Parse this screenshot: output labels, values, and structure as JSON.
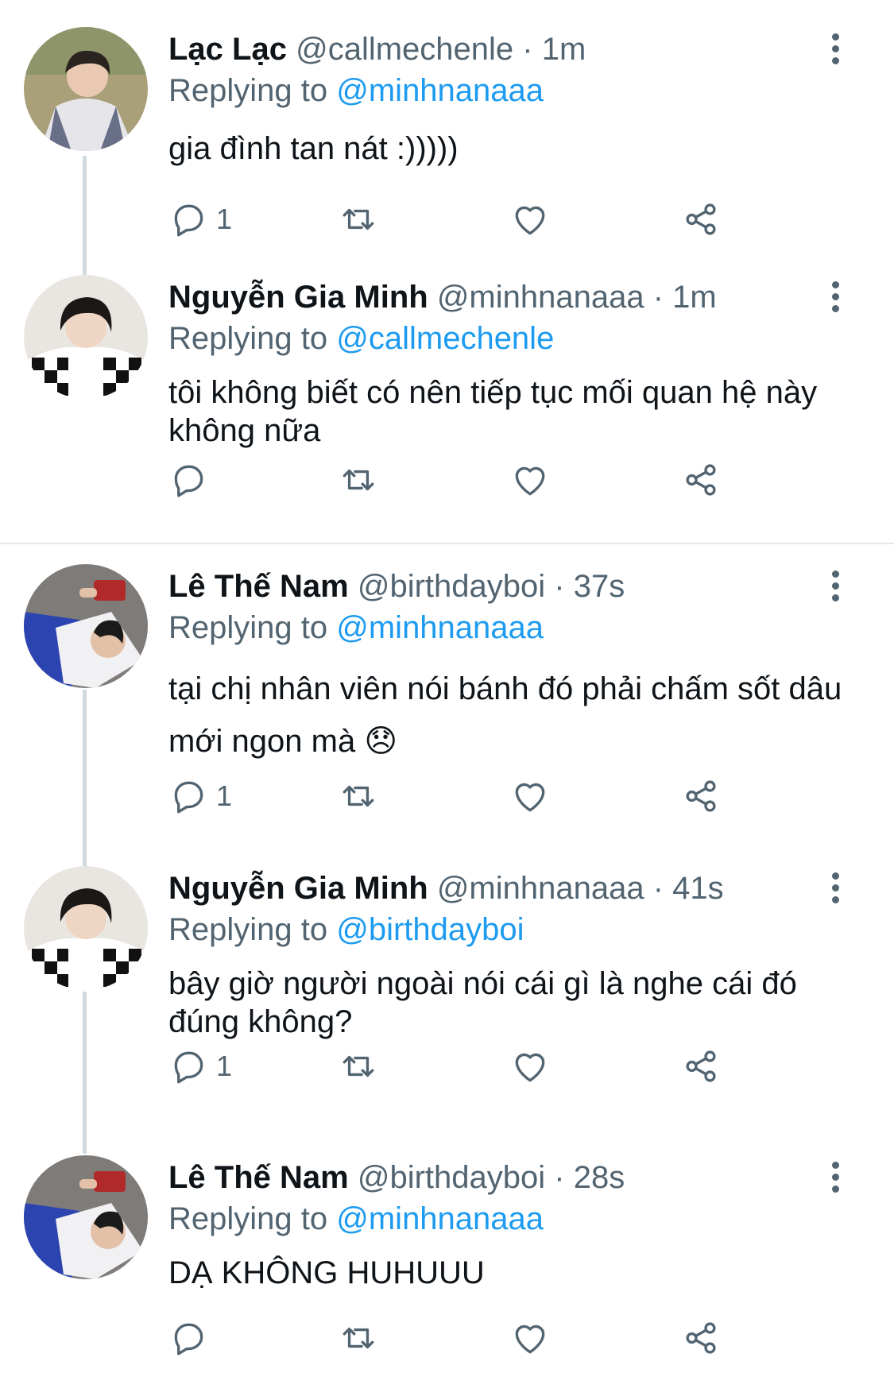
{
  "tweets": [
    {
      "name": "Lạc Lạc",
      "handle": "@callmechenle",
      "time": "1m",
      "replying_prefix": "Replying to",
      "replying_to": "@minhnanaaa",
      "text": "gia đình tan nát :)))))",
      "reply_count": "1"
    },
    {
      "name": "Nguyễn Gia Minh",
      "handle": "@minhnanaaa",
      "time": "1m",
      "replying_prefix": "Replying to",
      "replying_to": "@callmechenle",
      "text": "tôi không biết có nên tiếp tục mối quan hệ này không nữa",
      "reply_count": ""
    },
    {
      "name": "Lê Thế Nam",
      "handle": "@birthdayboi",
      "time": "37s",
      "replying_prefix": "Replying to",
      "replying_to": "@minhnanaaa",
      "text": "tại chị nhân viên nói bánh đó phải chấm sốt dâu mới ngon mà 😞",
      "reply_count": "1"
    },
    {
      "name": "Nguyễn Gia Minh",
      "handle": "@minhnanaaa",
      "time": "41s",
      "replying_prefix": "Replying to",
      "replying_to": "@birthdayboi",
      "text": "bây giờ người ngoài nói cái gì là nghe cái đó đúng không?",
      "reply_count": "1"
    },
    {
      "name": "Lê Thế Nam",
      "handle": "@birthdayboi",
      "time": "28s",
      "replying_prefix": "Replying to",
      "replying_to": "@minhnanaaa",
      "text": "DẠ KHÔNG HUHUUU",
      "reply_count": ""
    }
  ],
  "separator": "·",
  "icons": {
    "reply": "speech-bubble-icon",
    "retweet": "retweet-arrows-icon",
    "like": "heart-outline-icon",
    "share": "share-nodes-icon",
    "more": "vertical-ellipsis-icon"
  },
  "colors": {
    "text": "#0f1419",
    "secondary": "#536471",
    "mention": "#1d9bf0",
    "thread_line": "#cfd9de"
  }
}
